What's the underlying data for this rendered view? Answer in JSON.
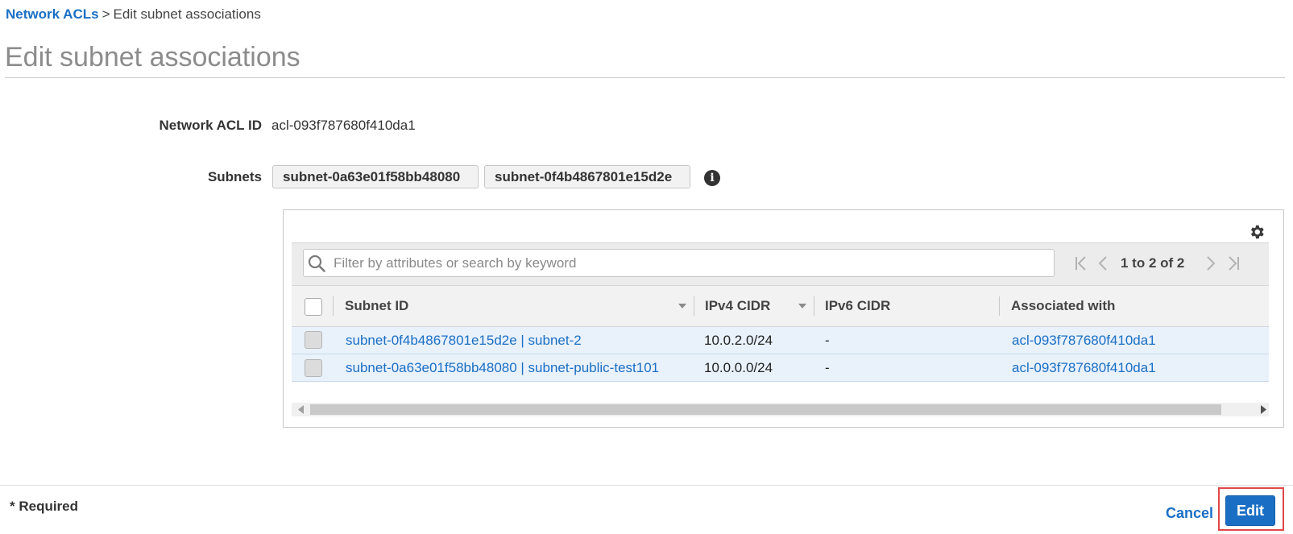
{
  "breadcrumb": {
    "parent": "Network ACLs",
    "separator": ">",
    "current": "Edit subnet associations"
  },
  "page_title": "Edit subnet associations",
  "form": {
    "acl_id_label": "Network ACL ID",
    "acl_id_value": "acl-093f787680f410da1",
    "subnets_label": "Subnets",
    "selected_subnets": [
      "subnet-0a63e01f58bb48080",
      "subnet-0f4b4867801e15d2e"
    ]
  },
  "table": {
    "search_placeholder": "Filter by attributes or search by keyword",
    "pagination": "1 to 2 of 2",
    "columns": [
      "Subnet ID",
      "IPv4 CIDR",
      "IPv6 CIDR",
      "Associated with"
    ],
    "rows": [
      {
        "subnet": "subnet-0f4b4867801e15d2e | subnet-2",
        "ipv4": "10.0.2.0/24",
        "ipv6": "-",
        "associated": "acl-093f787680f410da1"
      },
      {
        "subnet": "subnet-0a63e01f58bb48080 | subnet-public-test101",
        "ipv4": "10.0.0.0/24",
        "ipv6": "-",
        "associated": "acl-093f787680f410da1"
      }
    ]
  },
  "footer": {
    "required_note": "* Required",
    "cancel_label": "Cancel",
    "edit_label": "Edit"
  },
  "icons": {
    "info": "info-icon",
    "settings": "gear-icon",
    "search": "search-icon",
    "first_page": "first-page-icon",
    "prev_page": "prev-page-icon",
    "next_page": "next-page-icon",
    "last_page": "last-page-icon"
  },
  "colors": {
    "link": "#1a6fc4",
    "primary_button": "#1a6fc4",
    "row_selected_bg": "#e9f1fb",
    "highlight_border": "#e04848"
  }
}
